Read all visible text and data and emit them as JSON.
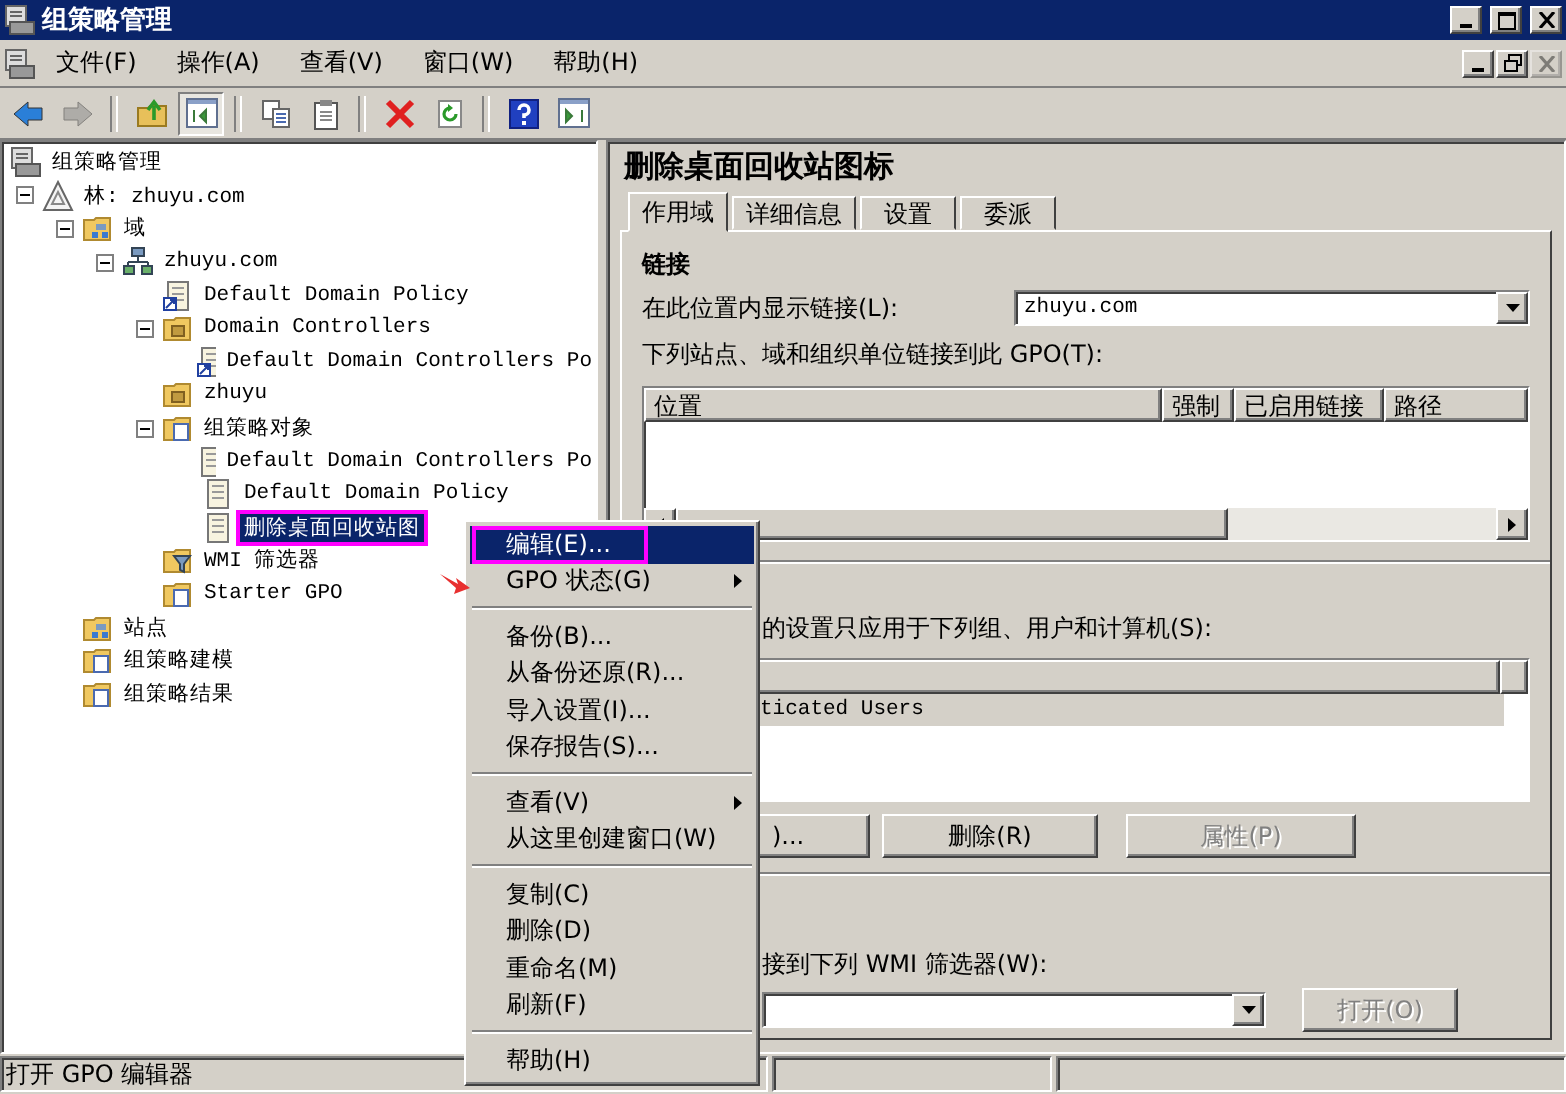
{
  "window": {
    "title": "组策略管理",
    "controls": [
      {
        "kind": "minimize"
      },
      {
        "kind": "maximize"
      },
      {
        "kind": "close"
      }
    ]
  },
  "menu_bar": {
    "items": [
      "文件(F)",
      "操作(A)",
      "查看(V)",
      "窗口(W)",
      "帮助(H)"
    ],
    "mdi_controls": [
      {
        "kind": "minimize",
        "disabled": false
      },
      {
        "kind": "restore",
        "disabled": false
      },
      {
        "kind": "close",
        "disabled": true
      }
    ]
  },
  "toolbar": [
    {
      "kind": "back",
      "disabled": false,
      "pressed": false
    },
    {
      "kind": "forward",
      "disabled": true,
      "pressed": false
    },
    {
      "kind": "separator"
    },
    {
      "kind": "up-folder",
      "disabled": false,
      "pressed": false
    },
    {
      "kind": "tree-toggle",
      "disabled": false,
      "pressed": true
    },
    {
      "kind": "separator"
    },
    {
      "kind": "copy",
      "disabled": false,
      "pressed": false
    },
    {
      "kind": "paste",
      "disabled": false,
      "pressed": false
    },
    {
      "kind": "separator"
    },
    {
      "kind": "delete",
      "disabled": false,
      "pressed": false
    },
    {
      "kind": "refresh",
      "disabled": false,
      "pressed": false
    },
    {
      "kind": "separator"
    },
    {
      "kind": "help",
      "disabled": false,
      "pressed": false
    },
    {
      "kind": "pane-toggle",
      "disabled": false,
      "pressed": false
    }
  ],
  "tree": {
    "label": "组策略管理",
    "kind": "console",
    "selected": false,
    "children": [
      {
        "label": "林: zhuyu.com",
        "kind": "forest",
        "selected": false,
        "expanded": true,
        "children": [
          {
            "label": "域",
            "kind": "network-folder",
            "selected": false,
            "expanded": true,
            "children": [
              {
                "label": "zhuyu.com",
                "kind": "network",
                "selected": false,
                "expanded": true,
                "children": [
                  {
                    "label": "Default Domain Policy",
                    "kind": "gpo-link",
                    "selected": false
                  },
                  {
                    "label": "Domain Controllers",
                    "kind": "folder",
                    "selected": false,
                    "expanded": true,
                    "children": [
                      {
                        "label": "Default Domain Controllers Po",
                        "kind": "gpo-link",
                        "selected": false
                      }
                    ]
                  },
                  {
                    "label": "zhuyu",
                    "kind": "folder",
                    "selected": false
                  },
                  {
                    "label": "组策略对象",
                    "kind": "doc-folder",
                    "selected": false,
                    "expanded": true,
                    "children": [
                      {
                        "label": "Default Domain Controllers Po",
                        "kind": "gpo",
                        "selected": false
                      },
                      {
                        "label": "Default Domain Policy",
                        "kind": "gpo",
                        "selected": false
                      },
                      {
                        "label": "删除桌面回收站图",
                        "kind": "gpo",
                        "selected": true
                      }
                    ]
                  },
                  {
                    "label": "WMI 筛选器",
                    "kind": "filter-folder",
                    "selected": false
                  },
                  {
                    "label": "Starter GPO",
                    "kind": "doc-folder",
                    "selected": false
                  }
                ]
              }
            ]
          },
          {
            "label": "站点",
            "kind": "network-folder",
            "selected": false
          },
          {
            "label": "组策略建模",
            "kind": "doc-folder",
            "selected": false
          },
          {
            "label": "组策略结果",
            "kind": "doc-folder",
            "selected": false
          }
        ]
      }
    ]
  },
  "detail": {
    "title": "删除桌面回收站图标",
    "tabs": [
      {
        "label": "作用域",
        "selected": true
      },
      {
        "label": "详细信息",
        "selected": false
      },
      {
        "label": "设置",
        "selected": false
      },
      {
        "label": "委派",
        "selected": false
      }
    ],
    "links": {
      "heading": "链接",
      "location_label": "在此位置内显示链接(L):",
      "location_value": "zhuyu.com",
      "list_label": "下列站点、域和组织单位链接到此 GPO(T):",
      "columns": [
        "位置",
        "强制",
        "已启用链接",
        "路径"
      ]
    },
    "security": {
      "label": "的设置只应用于下列组、用户和计算机(S):",
      "rows": [
        "ticated Users"
      ],
      "buttons": [
        {
          "label": ")...",
          "disabled": false
        },
        {
          "label": "删除(R)",
          "disabled": false
        },
        {
          "label": "属性(P)",
          "disabled": true
        }
      ]
    },
    "wmi": {
      "label": "接到下列 WMI 筛选器(W):",
      "open_button": {
        "label": "打开(O)",
        "disabled": true
      }
    }
  },
  "context_menu": [
    {
      "kind": "item",
      "label": "编辑(E)...",
      "selected": true,
      "submenu": false
    },
    {
      "kind": "item",
      "label": "GPO 状态(G)",
      "selected": false,
      "submenu": true
    },
    {
      "kind": "separator"
    },
    {
      "kind": "item",
      "label": "备份(B)...",
      "selected": false,
      "submenu": false
    },
    {
      "kind": "item",
      "label": "从备份还原(R)...",
      "selected": false,
      "submenu": false
    },
    {
      "kind": "item",
      "label": "导入设置(I)...",
      "selected": false,
      "submenu": false
    },
    {
      "kind": "item",
      "label": "保存报告(S)...",
      "selected": false,
      "submenu": false
    },
    {
      "kind": "separator"
    },
    {
      "kind": "item",
      "label": "查看(V)",
      "selected": false,
      "submenu": true
    },
    {
      "kind": "item",
      "label": "从这里创建窗口(W)",
      "selected": false,
      "submenu": false
    },
    {
      "kind": "separator"
    },
    {
      "kind": "item",
      "label": "复制(C)",
      "selected": false,
      "submenu": false
    },
    {
      "kind": "item",
      "label": "删除(D)",
      "selected": false,
      "submenu": false
    },
    {
      "kind": "item",
      "label": "重命名(M)",
      "selected": false,
      "submenu": false
    },
    {
      "kind": "item",
      "label": "刷新(F)",
      "selected": false,
      "submenu": false
    },
    {
      "kind": "separator"
    },
    {
      "kind": "item",
      "label": "帮助(H)",
      "selected": false,
      "submenu": false
    }
  ],
  "status_bar": {
    "text": "打开 GPO 编辑器"
  }
}
